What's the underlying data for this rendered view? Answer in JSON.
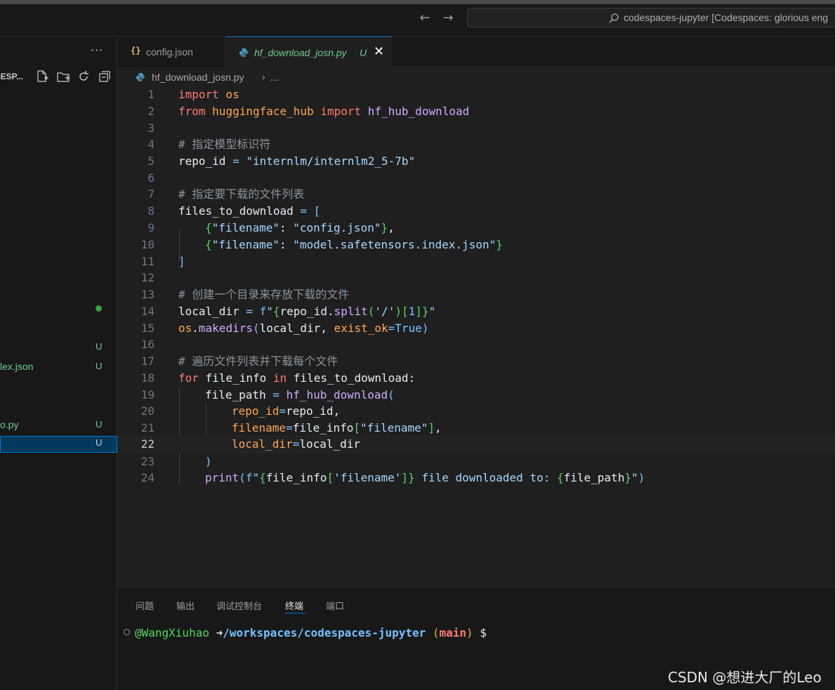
{
  "titlebar": {
    "search_text": "codespaces-jupyter [Codespaces: glorious eng"
  },
  "sidebar": {
    "more_label": "···",
    "section_title": "DESP...",
    "files": [
      {
        "name": "",
        "badge": "U"
      },
      {
        "name": "lex.json",
        "badge": "U"
      },
      {
        "name": "o.py",
        "badge": "U"
      },
      {
        "name": "",
        "badge": "U"
      }
    ]
  },
  "tabs": [
    {
      "label": "config.json",
      "icon": "json-icon"
    },
    {
      "label": "hf_download_josn.py",
      "status": "U",
      "icon": "python-icon"
    }
  ],
  "breadcrumb": {
    "file": "hf_download_josn.py",
    "separator": "›",
    "rest": "..."
  },
  "editor": {
    "line_numbers": [
      "1",
      "2",
      "3",
      "4",
      "5",
      "6",
      "7",
      "8",
      "9",
      "10",
      "11",
      "12",
      "13",
      "14",
      "15",
      "16",
      "17",
      "18",
      "19",
      "20",
      "21",
      "22",
      "23",
      "24"
    ],
    "active_line": 22,
    "t": {
      "import": "import",
      "os": "os",
      "from": "from",
      "huggingface_hub": "huggingface_hub",
      "hf_hub_download": "hf_hub_download",
      "c1": "# 指定模型标识符",
      "repo_id": "repo_id",
      "eq": " = ",
      "repo_val": "\"internlm/internlm2_5-7b\"",
      "c2": "# 指定要下载的文件列表",
      "files_to_download": "files_to_download",
      "lbr": "[",
      "rbr": "]",
      "lcb": "{",
      "rcb": "}",
      "filename_key": "\"filename\"",
      "colon": ": ",
      "config_json": "\"config.json\"",
      "comma": ",",
      "model_json": "\"model.safetensors.index.json\"",
      "c3": "# 创建一个目录来存放下载的文件",
      "local_dir": "local_dir",
      "f": "f",
      "fq": "\"",
      "split": "split",
      "lp": "(",
      "rp": ")",
      "slash": "'/'",
      "one": "1",
      "dot": ".",
      "makedirs": "makedirs",
      "exist_ok": "exist_ok",
      "eqs": "=",
      "True": "True",
      "commasp": ", ",
      "c4": "# 遍历文件列表并下载每个文件",
      "for": "for",
      "file_info": "file_info",
      "in": "in",
      "colon2": ":",
      "file_path": "file_path",
      "filename": "filename",
      "print": "print",
      "filename_sq": "'filename'",
      "downloaded_to": " file downloaded to: "
    }
  },
  "panel": {
    "tabs": [
      "问题",
      "输出",
      "调试控制台",
      "终端",
      "端口"
    ],
    "active_tab": "终端",
    "terminal": {
      "user": "@WangXiuhao",
      "arrow": "➜",
      "path": "/workspaces/codespaces-jupyter",
      "branch_open": "(",
      "branch": "main",
      "branch_close": ")",
      "prompt": "$"
    }
  },
  "watermark": "CSDN @想进大厂的Leo"
}
